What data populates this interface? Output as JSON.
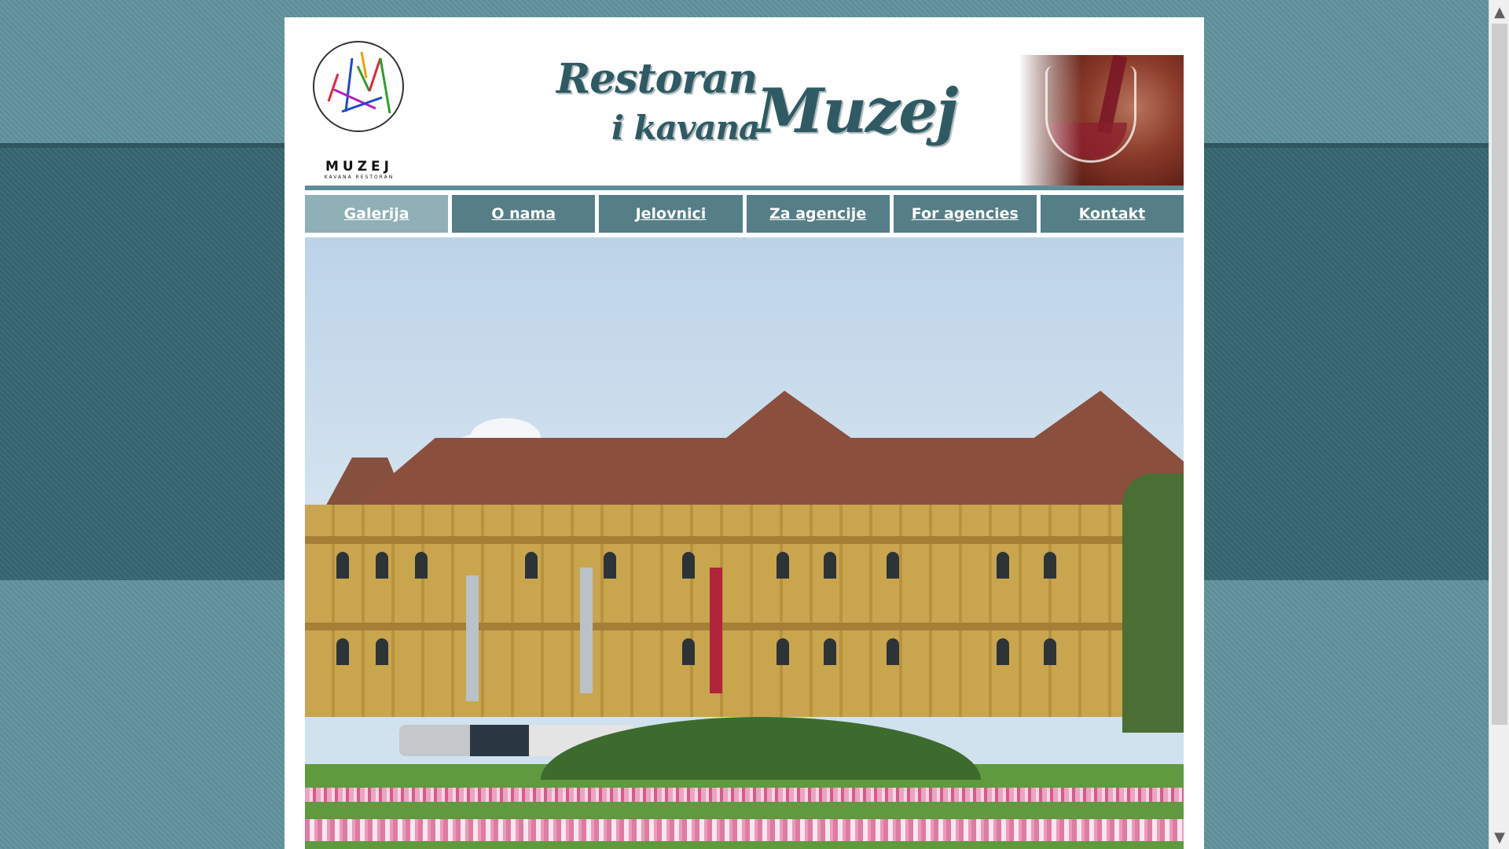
{
  "brand": {
    "logo_word": "MUZEJ",
    "logo_sub": "KAVANA RESTORAN",
    "title_line1": "Restoran",
    "title_line2": "i kavana",
    "title_name": "Muzej"
  },
  "nav": {
    "items": [
      {
        "label": "Galerija",
        "active": true
      },
      {
        "label": "O nama",
        "active": false
      },
      {
        "label": "Jelovnici",
        "active": false
      },
      {
        "label": "Za agencije",
        "active": false
      },
      {
        "label": "For agencies",
        "active": false
      },
      {
        "label": "Kontakt",
        "active": false
      }
    ]
  },
  "icons": {
    "scroll_up": "▲",
    "scroll_down": "▼"
  },
  "colors": {
    "accent": "#557e86",
    "active_tab": "#8fb0b6",
    "title": "#2f5a63"
  }
}
